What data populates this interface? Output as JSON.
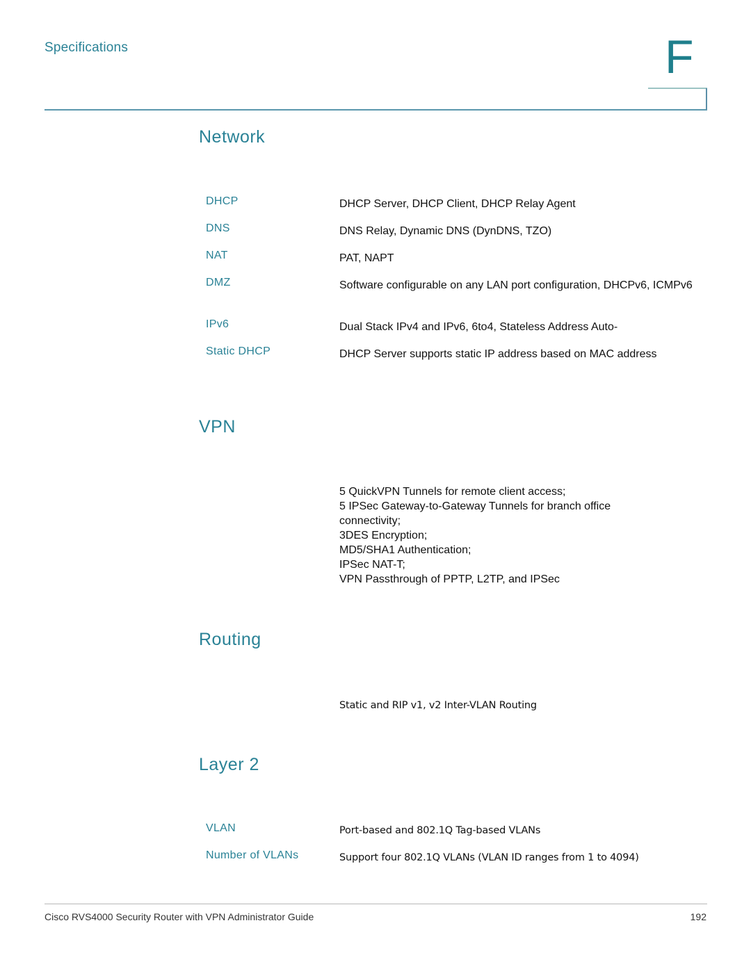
{
  "header": {
    "running_head": "Specifications",
    "chapter_letter": "F"
  },
  "sections": {
    "network": {
      "title": "Network",
      "rows": [
        {
          "label": "DHCP",
          "value": "DHCP Server, DHCP Client, DHCP Relay Agent"
        },
        {
          "label": "DNS",
          "value": "DNS Relay, Dynamic DNS (DynDNS, TZO)"
        },
        {
          "label": "NAT",
          "value": "PAT, NAPT"
        },
        {
          "label": "DMZ",
          "value": "Software configurable on any LAN port configuration, DHCPv6, ICMPv6"
        },
        {
          "label": "IPv6",
          "value": "Dual Stack IPv4 and IPv6, 6to4, Stateless Address Auto-"
        },
        {
          "label": "Static DHCP",
          "value": "DHCP Server supports static IP address based on MAC address"
        }
      ]
    },
    "vpn": {
      "title": "VPN",
      "lines": [
        "5 QuickVPN Tunnels for remote client access;",
        "5 IPSec Gateway-to-Gateway Tunnels for branch office connectivity;",
        "3DES Encryption;",
        "MD5/SHA1 Authentication;",
        "IPSec NAT-T;",
        "VPN Passthrough of PPTP, L2TP, and IPSec"
      ]
    },
    "routing": {
      "title": "Routing",
      "value": "Static and RIP v1, v2 Inter-VLAN Routing"
    },
    "layer2": {
      "title": "Layer 2",
      "rows": [
        {
          "label": "VLAN",
          "value": "Port-based and 802.1Q Tag-based VLANs"
        },
        {
          "label": "Number of VLANs",
          "value": "Support four 802.1Q VLANs (VLAN ID ranges from 1 to 4094)"
        }
      ]
    }
  },
  "footer": {
    "title": "Cisco RVS4000 Security Router with VPN Administrator Guide",
    "page_number": "192"
  }
}
